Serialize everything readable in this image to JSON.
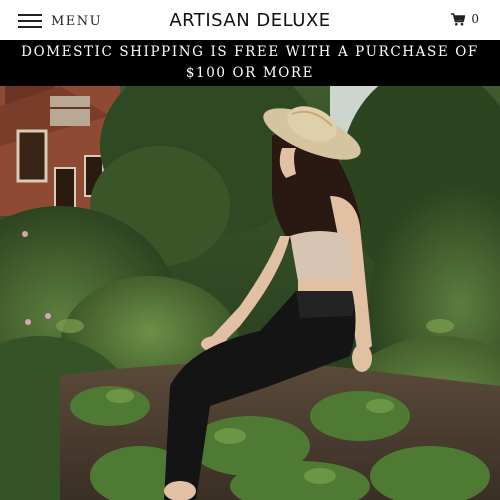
{
  "header": {
    "menu_label": "MENU",
    "logo_text": "ARTISAN DELUXE",
    "cart_count": "0"
  },
  "announcement": {
    "line1": "DOMESTIC SHIPPING IS FREE WITH A PURCHASE OF",
    "line2": "$100 OR MORE"
  },
  "icons": {
    "menu": "hamburger-menu-icon",
    "cart": "shopping-cart-icon"
  },
  "colors": {
    "announcement_bg": "#000000",
    "announcement_text": "#ffffff",
    "header_bg": "#ffffff"
  }
}
